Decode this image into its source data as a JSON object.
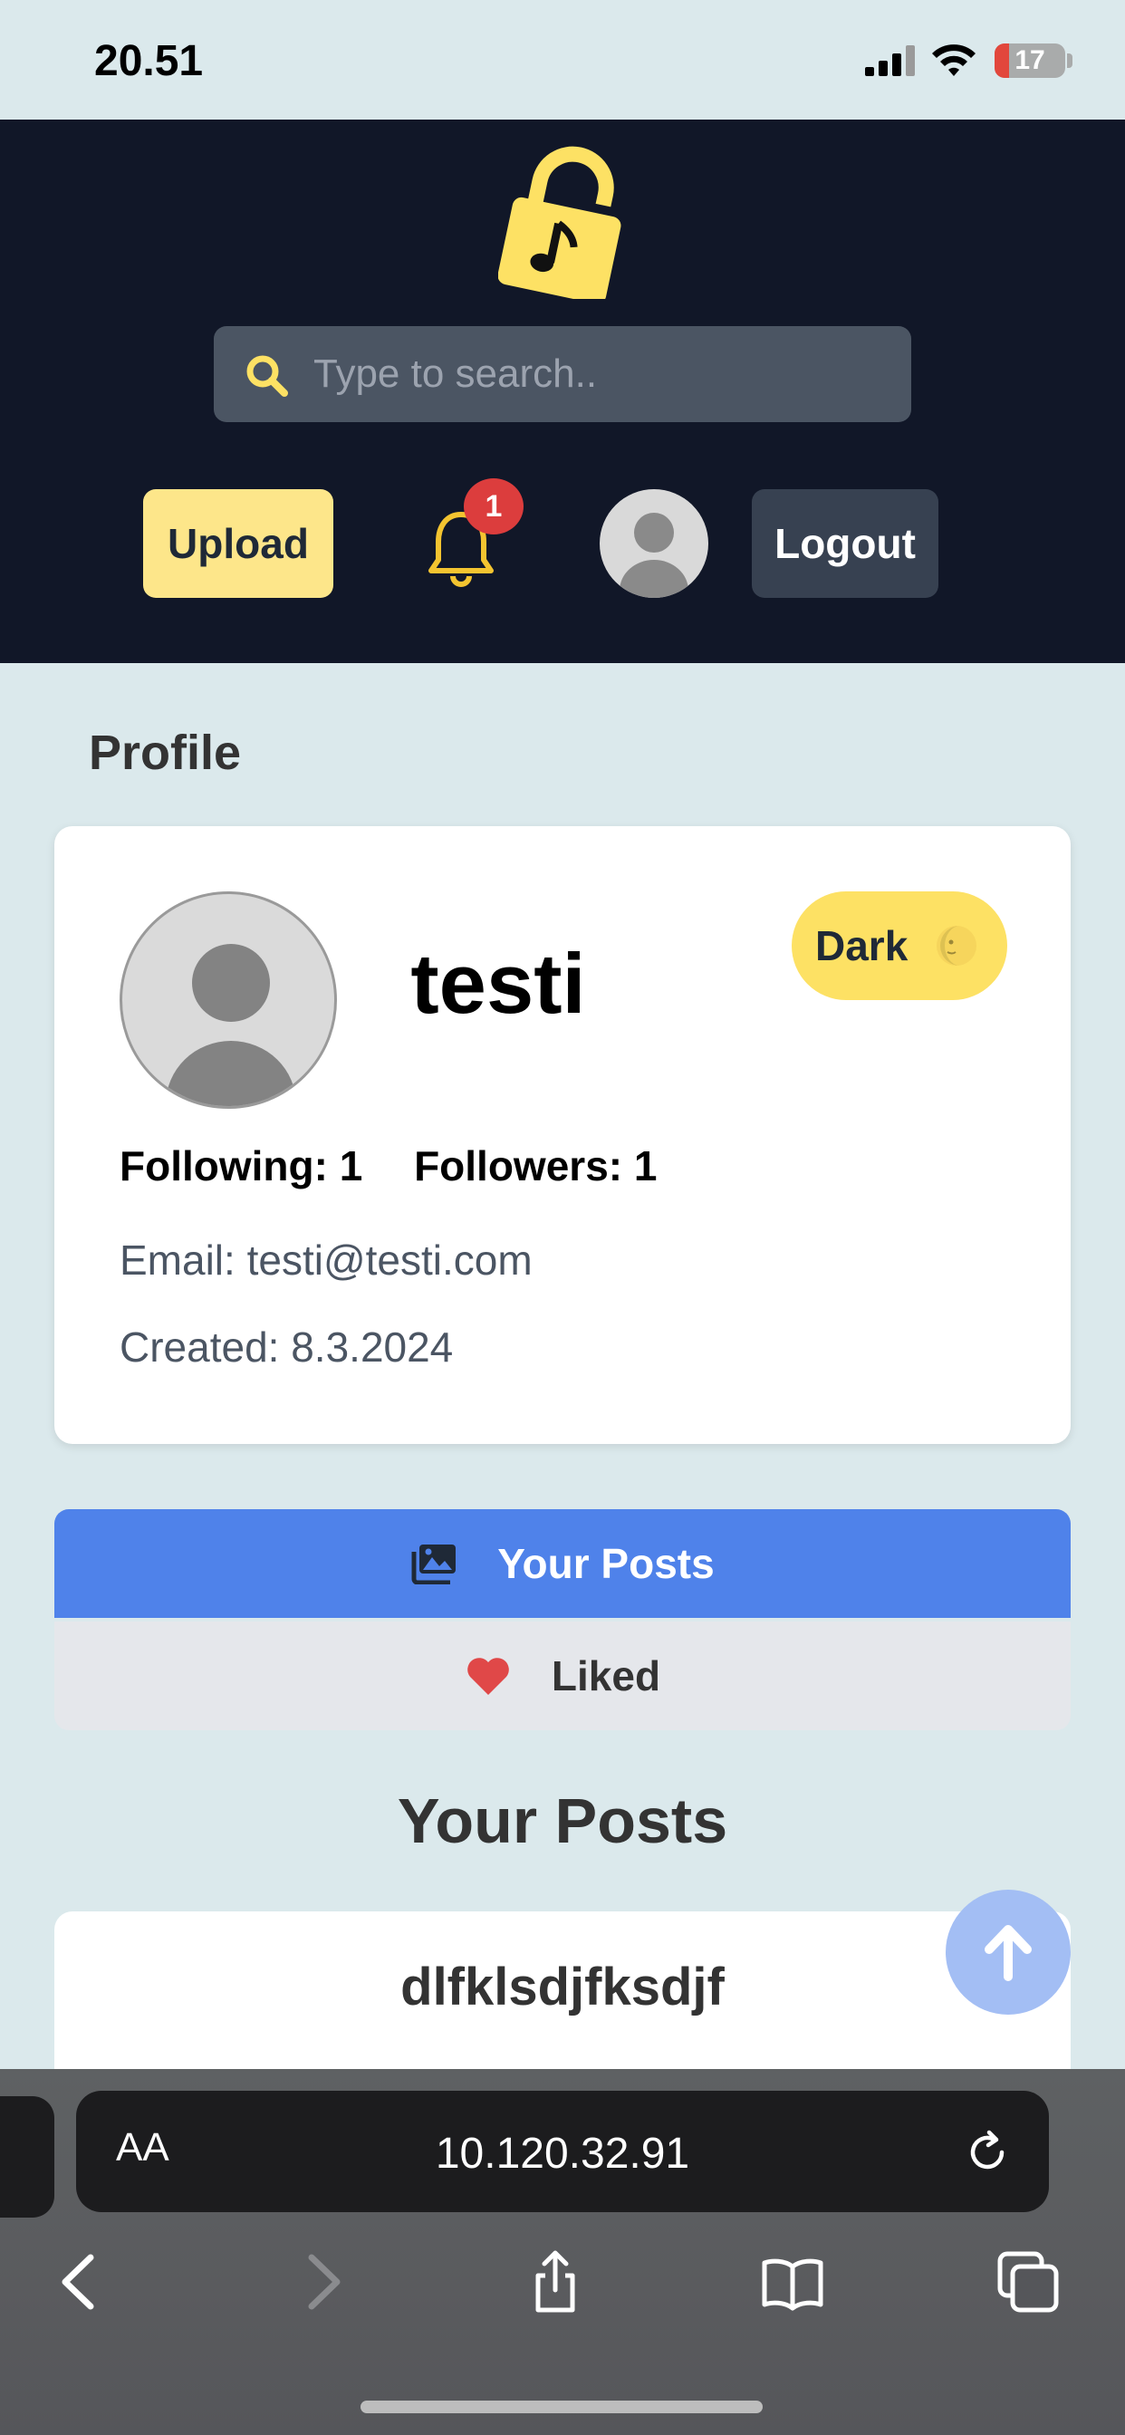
{
  "status_bar": {
    "time": "20.51",
    "battery_level": "17",
    "battery_color": "#e2473c"
  },
  "header": {
    "logo_icon": "lock-music-icon",
    "search": {
      "placeholder": "Type to search..",
      "value": ""
    },
    "upload_label": "Upload",
    "notification_count": "1",
    "logout_label": "Logout"
  },
  "profile": {
    "heading": "Profile",
    "username": "testi",
    "theme_toggle_label": "Dark",
    "following": "Following: 1",
    "followers": "Followers: 1",
    "email": "Email: testi@testi.com",
    "created": "Created: 8.3.2024"
  },
  "tabs": [
    {
      "label": "Your Posts",
      "icon": "images-icon",
      "active": true
    },
    {
      "label": "Liked",
      "icon": "heart-icon",
      "active": false
    }
  ],
  "posts": {
    "heading": "Your Posts",
    "items": [
      {
        "title": "dlfklsdjfksdjf"
      }
    ]
  },
  "browser": {
    "text_size_label": "AA",
    "url": "10.120.32.91"
  },
  "colors": {
    "header_bg": "#111728",
    "accent_yellow": "#fde68a",
    "active_tab": "#4f82ea",
    "page_bg": "#dbe9ec"
  }
}
